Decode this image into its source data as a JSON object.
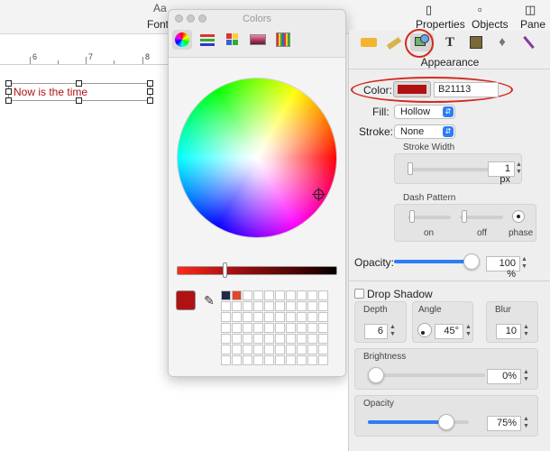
{
  "toolbar": {
    "font_glyph": "Aa",
    "fonts_label": "Fonts",
    "properties_label": "Properties",
    "objects_label": "Objects",
    "pane_label": "Pane"
  },
  "ruler": {
    "numbers": [
      "6",
      "7",
      "8"
    ]
  },
  "canvas": {
    "text_object": "Now is the time"
  },
  "colors_panel": {
    "title": "Colors",
    "tabs": [
      "color-wheel",
      "color-sliders",
      "color-palettes",
      "image-palettes",
      "pencils"
    ],
    "current_color": "#b21113"
  },
  "inspector": {
    "section_title": "Appearance",
    "color_label": "Color:",
    "color_hex": "B21113",
    "fill_label": "Fill:",
    "fill_value": "Hollow",
    "stroke_label": "Stroke:",
    "stroke_value": "None",
    "stroke_width_label": "Stroke Width",
    "stroke_width_value": "1 px",
    "dash_pattern_label": "Dash Pattern",
    "dash_on": "on",
    "dash_off": "off",
    "dash_phase": "phase",
    "opacity_label": "Opacity:",
    "opacity_value": "100 %",
    "drop_shadow_label": "Drop Shadow",
    "depth_label": "Depth",
    "depth_value": "6",
    "angle_label": "Angle",
    "angle_value": "45°",
    "blur_label": "Blur",
    "blur_value": "10",
    "brightness_label": "Brightness",
    "brightness_value": "0%",
    "shadow_opacity_label": "Opacity",
    "shadow_opacity_value": "75%",
    "opacity_level": 1.0,
    "brightness_level": 0.0,
    "shadow_opacity_level": 0.75
  },
  "colors": {
    "accent": "#2e7cf6",
    "annotation_red": "#d42a1d",
    "text_red": "#b21113"
  }
}
